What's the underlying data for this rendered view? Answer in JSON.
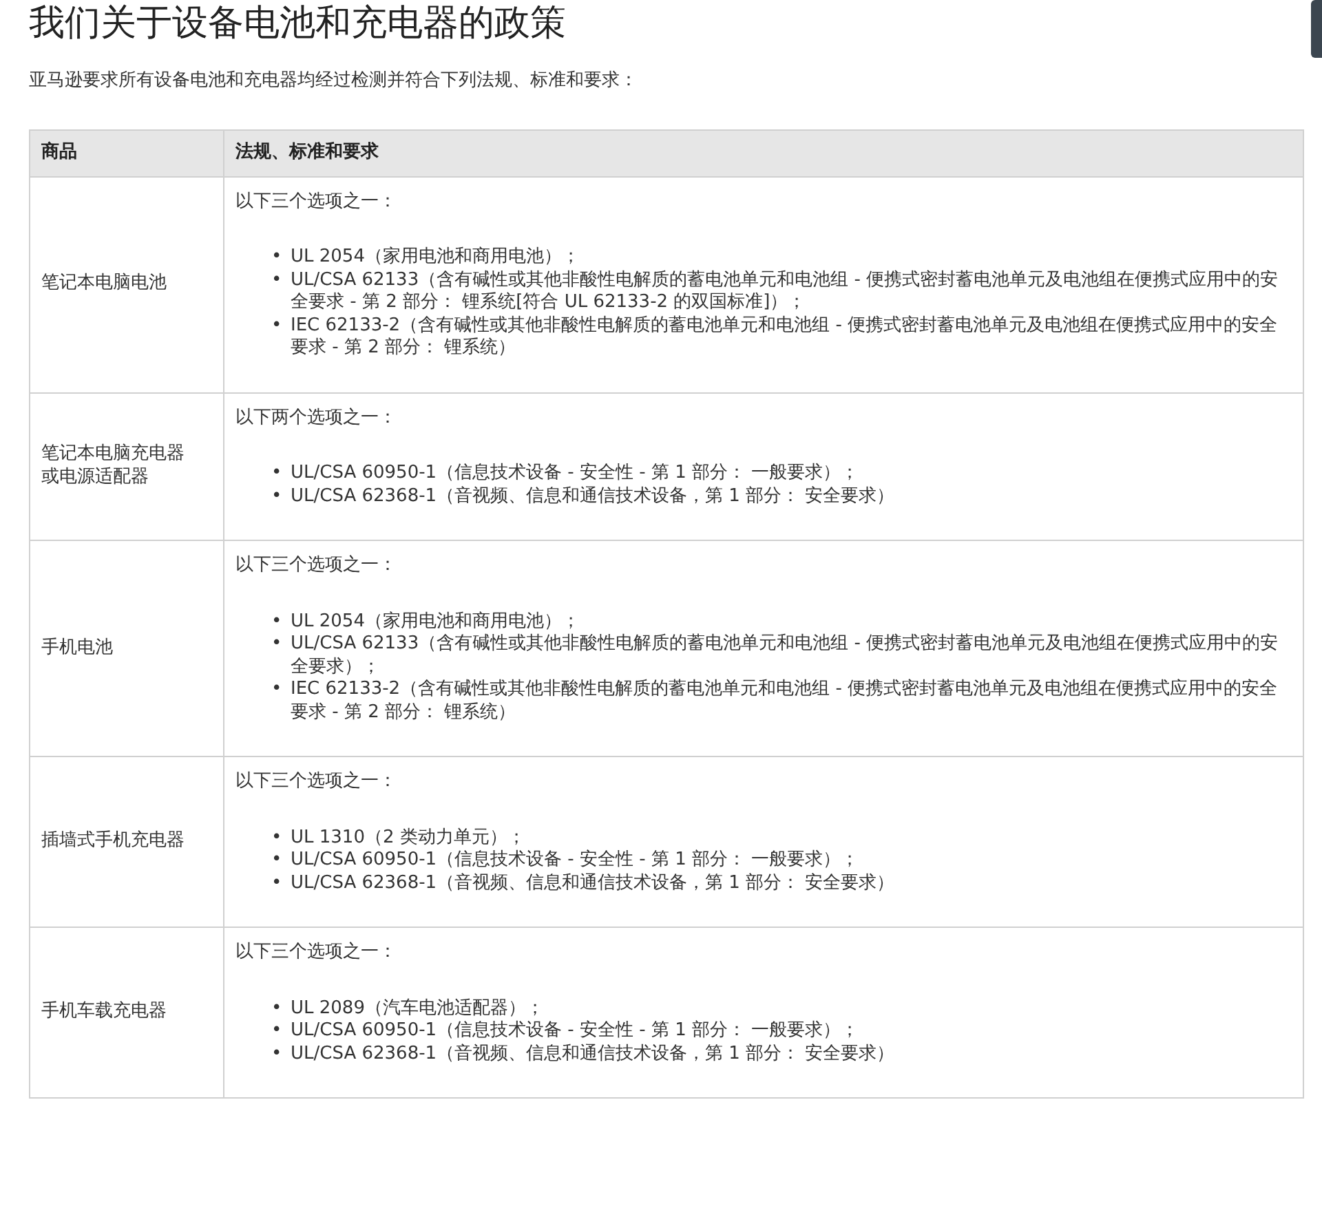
{
  "title": "我们关于设备电池和充电器的政策",
  "intro": "亚马逊要求所有设备电池和充电器均经过检测并符合下列法规、标准和要求：",
  "table": {
    "bullet": "•",
    "columns": [
      "商品",
      "法规、标准和要求"
    ],
    "rows": [
      {
        "product": "笔记本电脑电池",
        "lead": "以下三个选项之一：",
        "items": [
          "UL 2054（家用电池和商用电池）；",
          "UL/CSA 62133（含有碱性或其他非酸性电解质的蓄电池单元和电池组 - 便携式密封蓄电池单元及电池组在便携式应用中的安全要求 - 第 2 部分： 锂系统[符合 UL 62133-2 的双国标准]）；",
          "IEC 62133-2（含有碱性或其他非酸性电解质的蓄电池单元和电池组 - 便携式密封蓄电池单元及电池组在便携式应用中的安全要求 - 第 2 部分： 锂系统）"
        ]
      },
      {
        "product": "笔记本电脑充电器或电源适配器",
        "lead": "以下两个选项之一：",
        "items": [
          "UL/CSA 60950-1（信息技术设备 - 安全性 - 第 1 部分： 一般要求）；",
          "UL/CSA 62368-1（音视频、信息和通信技术设备，第 1 部分： 安全要求）"
        ]
      },
      {
        "product": "手机电池",
        "lead": "以下三个选项之一：",
        "items": [
          "UL 2054（家用电池和商用电池）；",
          "UL/CSA 62133（含有碱性或其他非酸性电解质的蓄电池单元和电池组 - 便携式密封蓄电池单元及电池组在便携式应用中的安全要求）；",
          "IEC 62133-2（含有碱性或其他非酸性电解质的蓄电池单元和电池组 - 便携式密封蓄电池单元及电池组在便携式应用中的安全要求 - 第 2 部分： 锂系统）"
        ]
      },
      {
        "product": "插墙式手机充电器",
        "lead": "以下三个选项之一：",
        "items": [
          "UL 1310（2 类动力单元）；",
          "UL/CSA 60950-1（信息技术设备 - 安全性 - 第 1 部分： 一般要求）；",
          "UL/CSA 62368-1（音视频、信息和通信技术设备，第 1 部分： 安全要求）"
        ]
      },
      {
        "product": "手机车载充电器",
        "lead": "以下三个选项之一：",
        "items": [
          "UL 2089（汽车电池适配器）；",
          "UL/CSA 60950-1（信息技术设备 - 安全性 - 第 1 部分： 一般要求）；",
          "UL/CSA 62368-1（音视频、信息和通信技术设备，第 1 部分： 安全要求）"
        ]
      }
    ]
  }
}
